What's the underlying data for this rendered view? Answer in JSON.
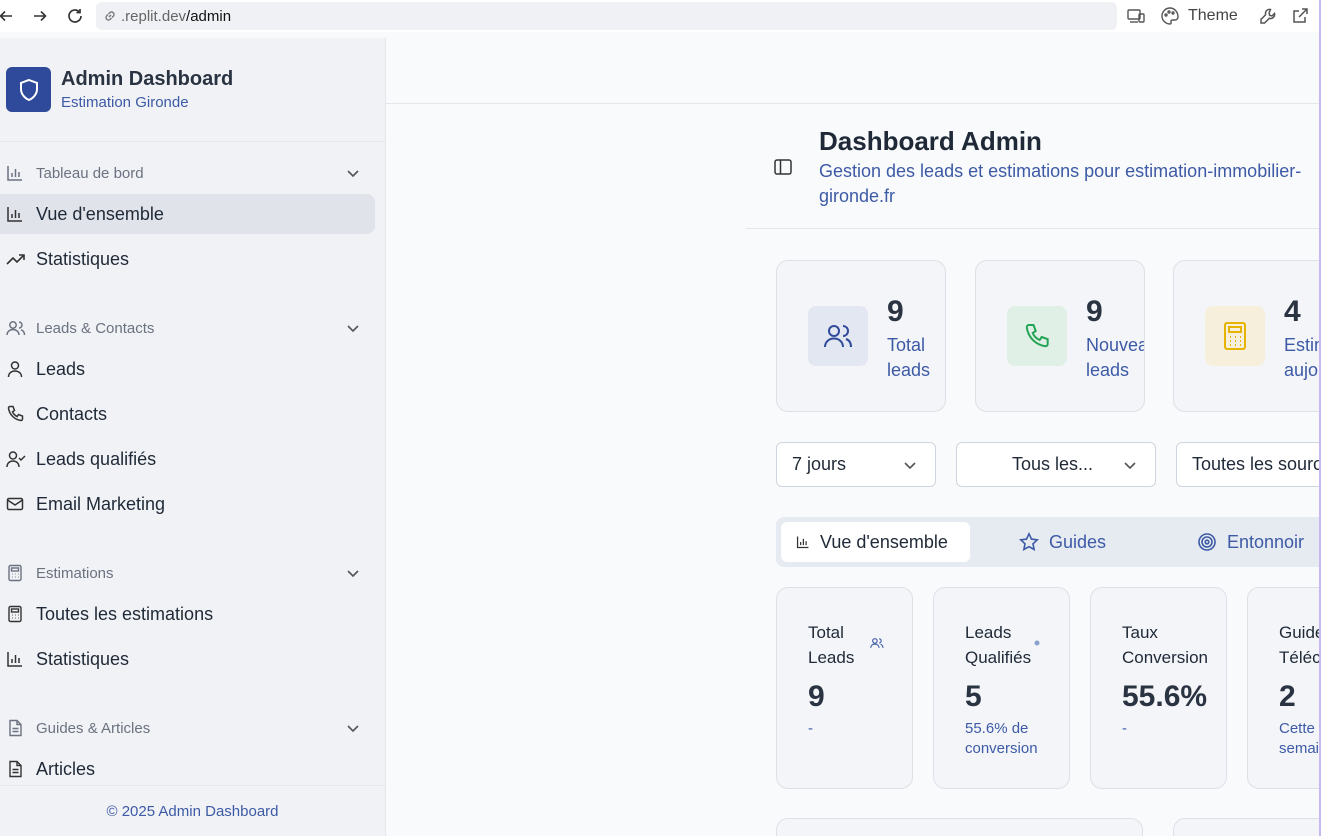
{
  "browser": {
    "url_host": ".replit.dev",
    "url_path": "/admin",
    "theme_label": "Theme"
  },
  "sidebar": {
    "title": "Admin Dashboard",
    "subtitle": "Estimation Gironde",
    "groups": [
      {
        "label": "Tableau de bord",
        "icon": "bar-chart-icon"
      },
      {
        "label": "Leads & Contacts",
        "icon": "users-icon"
      },
      {
        "label": "Estimations",
        "icon": "calculator-icon"
      },
      {
        "label": "Guides & Articles",
        "icon": "file-icon"
      }
    ],
    "items": [
      {
        "label": "Vue d'ensemble",
        "icon": "bar-chart-icon",
        "active": true
      },
      {
        "label": "Statistiques",
        "icon": "trending-up-icon"
      },
      {
        "label": "Leads",
        "icon": "user-icon"
      },
      {
        "label": "Contacts",
        "icon": "phone-icon"
      },
      {
        "label": "Leads qualifiés",
        "icon": "user-check-icon"
      },
      {
        "label": "Email Marketing",
        "icon": "mail-icon"
      },
      {
        "label": "Toutes les estimations",
        "icon": "calculator-icon"
      },
      {
        "label": "Statistiques",
        "icon": "bar-chart-icon"
      },
      {
        "label": "Articles",
        "icon": "file-text-icon"
      }
    ],
    "footer": "© 2025 Admin Dashboard"
  },
  "header": {
    "title": "Dashboard Admin",
    "description": "Gestion des leads et estimations pour estimation-immobilier-gironde.fr"
  },
  "stats": [
    {
      "value": "9",
      "label": "Total\nleads",
      "icon": "users-icon",
      "color": "#2f4a9a"
    },
    {
      "value": "9",
      "label": "Nouveaux\nleads",
      "icon": "phone-icon",
      "color": "#22a455"
    },
    {
      "value": "4",
      "label": "Estimations\naujourd'hui",
      "icon": "calculator-icon",
      "color": "#e6b400"
    }
  ],
  "filters": [
    {
      "value": "7 jours"
    },
    {
      "value": "Tous les..."
    },
    {
      "value": "Toutes les sources"
    }
  ],
  "tabs": [
    {
      "label": "Vue d'ensemble",
      "icon": "bar-chart-icon",
      "active": true
    },
    {
      "label": "Guides",
      "icon": "star-icon"
    },
    {
      "label": "Entonnoir",
      "icon": "target-icon"
    }
  ],
  "kpis": [
    {
      "title": "Total\nLeads",
      "value": "9",
      "sub": "-",
      "icon": "users-icon"
    },
    {
      "title": "Leads\nQualifiés",
      "value": "5",
      "sub": "55.6% de\nconversion",
      "icon": "dot-icon"
    },
    {
      "title": "Taux\nConversion",
      "value": "55.6%",
      "sub": "-",
      "icon": ""
    },
    {
      "title": "Guides\nTéléchargés",
      "value": "2",
      "sub": "Cette\nsemaine",
      "icon": ""
    }
  ]
}
